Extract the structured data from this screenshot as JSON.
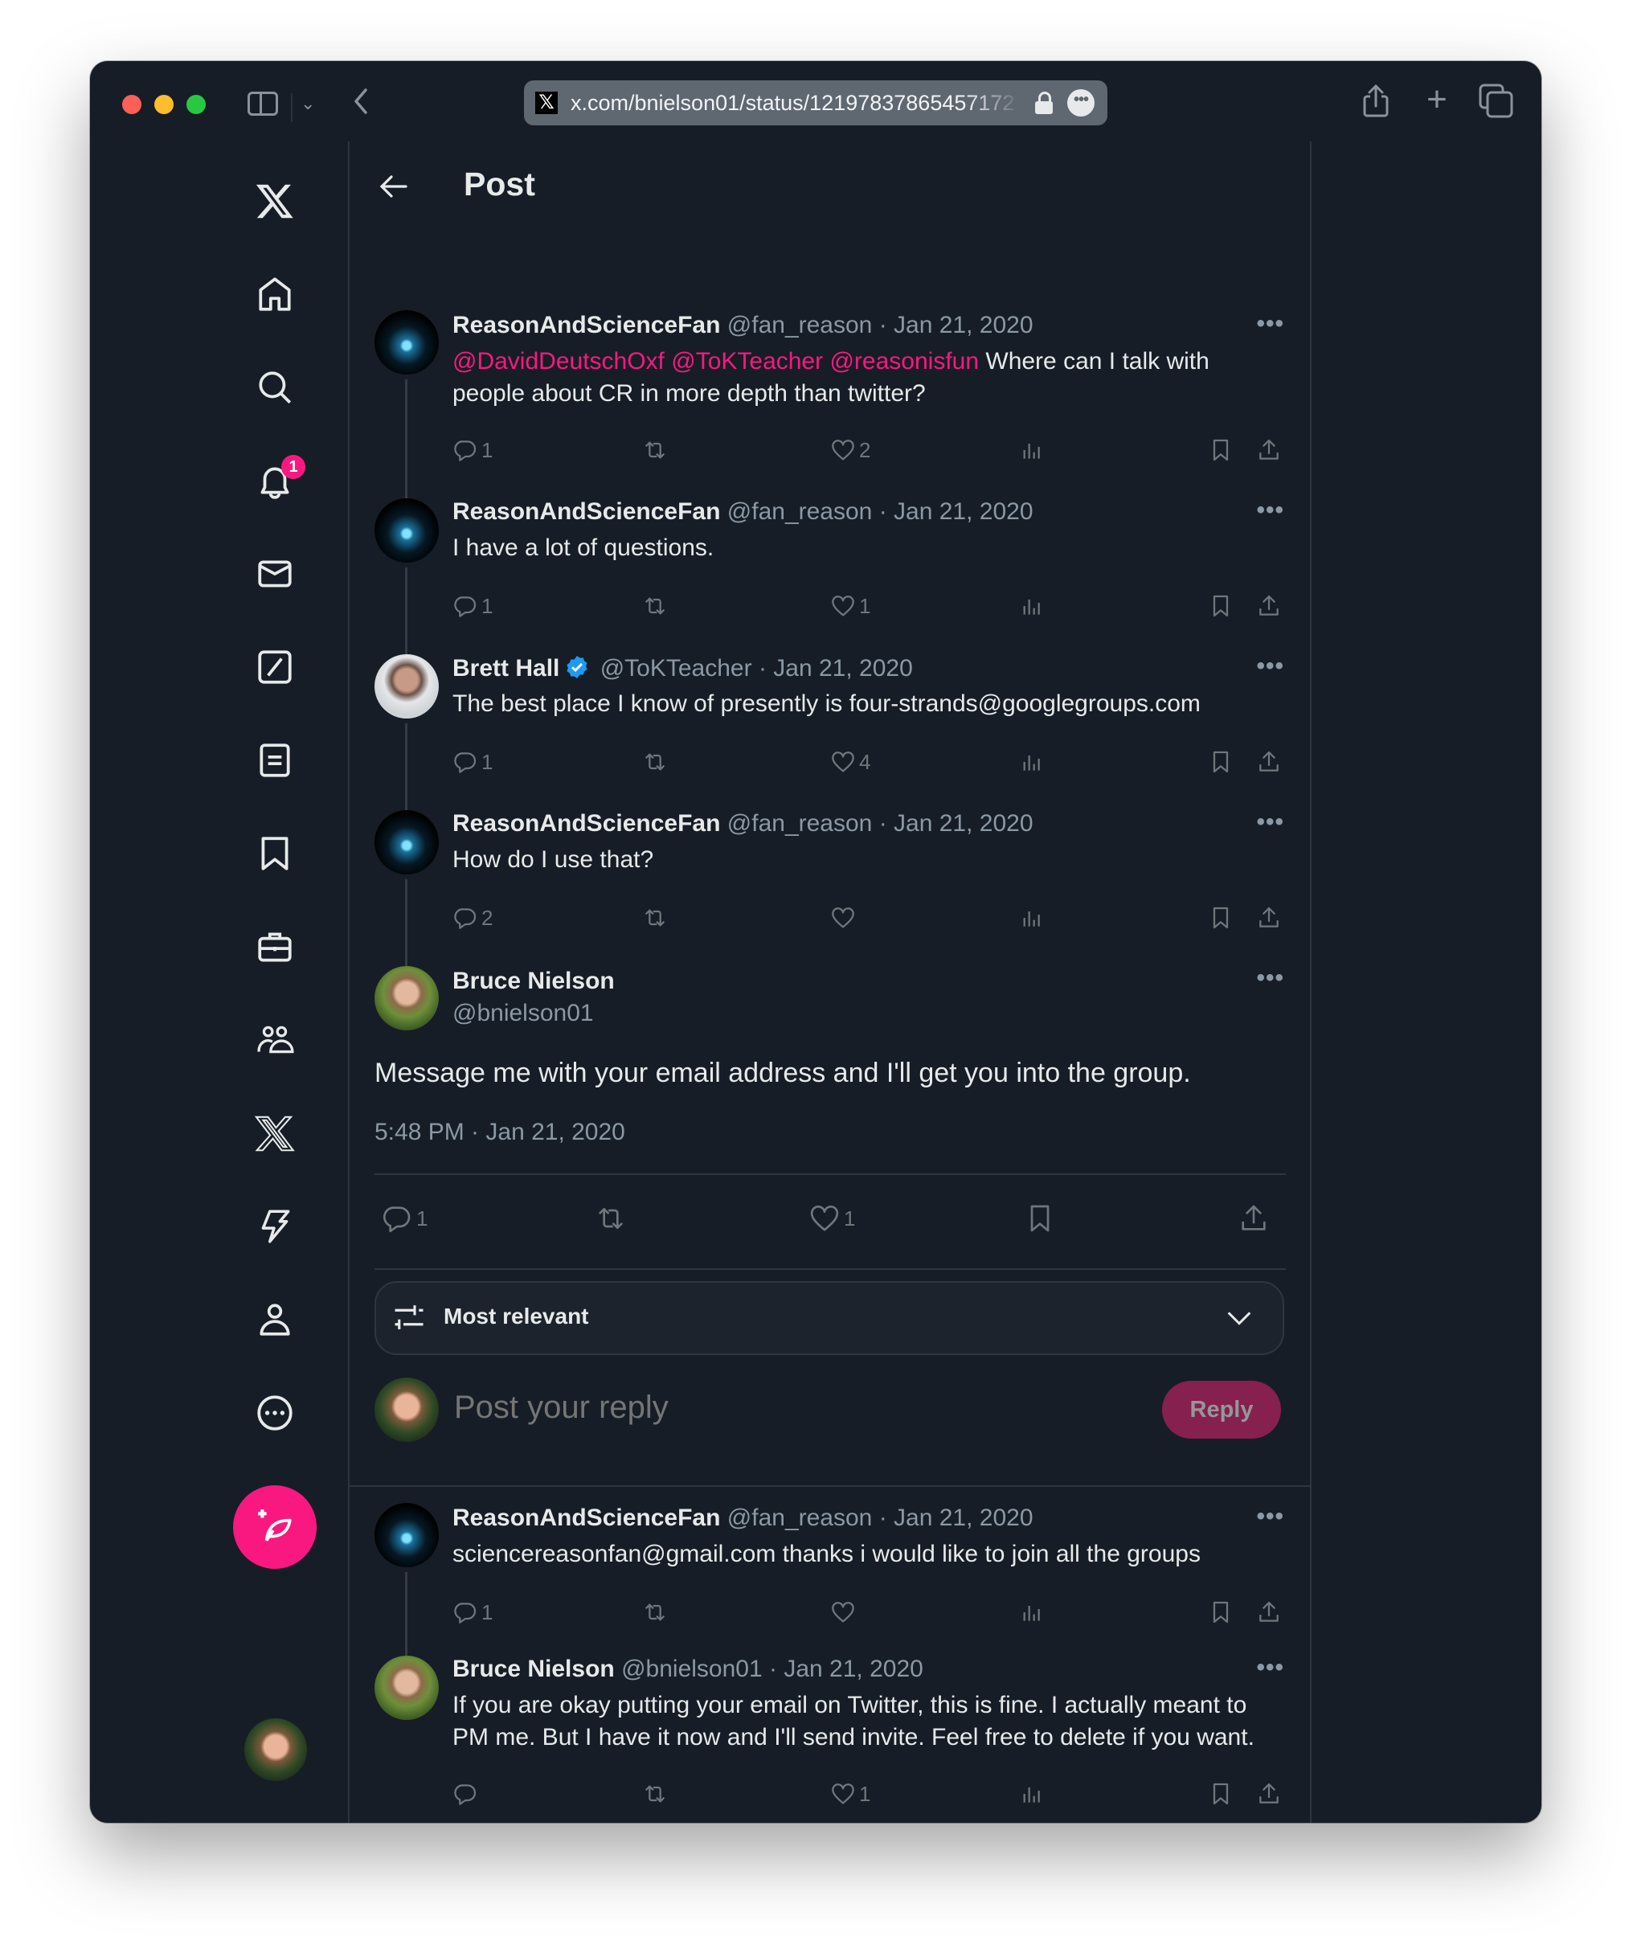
{
  "browser": {
    "url": "x.com/bnielson01/status/1219783786545717248",
    "url_display": "x.com/bnielson01/status/12197837865457172",
    "favicon": "x-logo-icon"
  },
  "sidebar": {
    "items": [
      {
        "name": "x-logo",
        "icon": "x-logo-icon"
      },
      {
        "name": "home",
        "icon": "home-icon"
      },
      {
        "name": "explore",
        "icon": "search-icon"
      },
      {
        "name": "notifications",
        "icon": "bell-icon",
        "badge": "1"
      },
      {
        "name": "messages",
        "icon": "envelope-icon"
      },
      {
        "name": "grok",
        "icon": "grok-icon"
      },
      {
        "name": "lists",
        "icon": "list-icon"
      },
      {
        "name": "bookmarks",
        "icon": "bookmark-icon"
      },
      {
        "name": "jobs",
        "icon": "briefcase-icon"
      },
      {
        "name": "communities",
        "icon": "people-icon"
      },
      {
        "name": "premium",
        "icon": "x-logo-icon"
      },
      {
        "name": "verified-orgs",
        "icon": "lightning-icon"
      },
      {
        "name": "profile",
        "icon": "person-icon"
      },
      {
        "name": "more",
        "icon": "more-circle-icon"
      }
    ],
    "compose_icon": "compose-feather-icon"
  },
  "header": {
    "title": "Post"
  },
  "thread": [
    {
      "name": "ReasonAndScienceFan",
      "handle": "@fan_reason",
      "date": "Jan 21, 2020",
      "mentions": [
        "@DavidDeutschOxf",
        "@ToKTeacher",
        "@reasonisfun"
      ],
      "text": "Where can I talk with people about CR in more depth than twitter?",
      "replies": "1",
      "retweets": "",
      "likes": "2"
    },
    {
      "name": "ReasonAndScienceFan",
      "handle": "@fan_reason",
      "date": "Jan 21, 2020",
      "text": "I have a lot of questions.",
      "replies": "1",
      "retweets": "",
      "likes": "1"
    },
    {
      "name": "Brett Hall",
      "verified": true,
      "handle": "@ToKTeacher",
      "date": "Jan 21, 2020",
      "text": "The best place I know of presently is four-strands@googlegroups.com",
      "replies": "1",
      "retweets": "",
      "likes": "4"
    },
    {
      "name": "ReasonAndScienceFan",
      "handle": "@fan_reason",
      "date": "Jan 21, 2020",
      "text": "How do I use that?",
      "replies": "2",
      "retweets": "",
      "likes": ""
    }
  ],
  "focus_post": {
    "name": "Bruce Nielson",
    "handle": "@bnielson01",
    "text": "Message me with your email address and I'll get you into the group.",
    "timestamp": "5:48 PM · Jan 21, 2020",
    "replies": "1",
    "retweets": "",
    "likes": "1"
  },
  "sort": {
    "label": "Most relevant"
  },
  "reply_box": {
    "placeholder": "Post your reply",
    "button": "Reply"
  },
  "replies": [
    {
      "name": "ReasonAndScienceFan",
      "handle": "@fan_reason",
      "date": "Jan 21, 2020",
      "text": "sciencereasonfan@gmail.com thanks i would like to join all the groups",
      "replies": "1",
      "retweets": "",
      "likes": ""
    },
    {
      "name": "Bruce Nielson",
      "handle": "@bnielson01",
      "date": "Jan 21, 2020",
      "text": "If you are okay putting your email on Twitter, this is fine. I actually meant to PM me. But I have it now and I'll send invite. Feel free to delete if you want.",
      "replies": "",
      "retweets": "",
      "likes": "1"
    }
  ],
  "separator": "·",
  "more_glyph": "•••",
  "colors": {
    "background": "#161d26",
    "accent": "#f91880",
    "verified": "#1d9bf0",
    "text": "#e7e9ea",
    "secondary_text": "#8b98a5"
  }
}
